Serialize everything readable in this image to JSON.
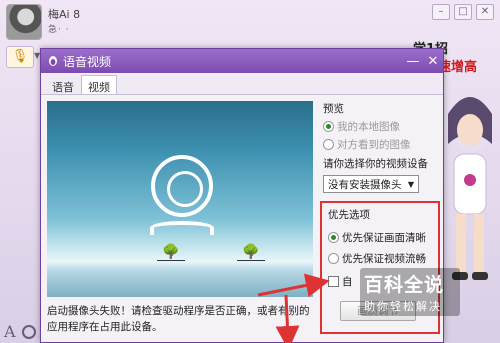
{
  "chat": {
    "contact_name": "梅Ai 8",
    "contact_sub": "急·      ·",
    "win_minimize": "–",
    "win_maximize": "□",
    "win_close": "✕",
    "mic_symbol": "🎙",
    "mic_arrow": "▼",
    "font_button": "A"
  },
  "promo": {
    "line1": "学1招",
    "line2": "速增高"
  },
  "dialog": {
    "title": "语音视频",
    "minimize_symbol": "—",
    "close_symbol": "✕",
    "tabs": [
      {
        "label": "语音",
        "active": false
      },
      {
        "label": "视频",
        "active": true
      }
    ],
    "status_message": "启动摄像头失败！请检查驱动程序是否正确，或者有别的应用程序在占用此设备。",
    "preview_section": {
      "label": "预览",
      "options": [
        {
          "label": "我的本地图像",
          "checked": true,
          "disabled": true
        },
        {
          "label": "对方看到的图像",
          "checked": false,
          "disabled": true
        }
      ]
    },
    "device_section": {
      "label": "请你选择你的视频设备",
      "selected": "没有安装摄像头",
      "caret": "▼"
    },
    "priority_section": {
      "label": "优先选项",
      "options": [
        {
          "label": "优先保证画面清晰",
          "checked": true
        },
        {
          "label": "优先保证视频流畅",
          "checked": false
        }
      ],
      "checkbox_label": "自",
      "adjust_button": "画质调节"
    }
  },
  "watermark": {
    "main": "百科全说",
    "sub": "助你轻松解决"
  },
  "colors": {
    "dialog_title": "#7c4bb0",
    "annotation_red": "#d33",
    "promo_red": "#d21b1b"
  }
}
